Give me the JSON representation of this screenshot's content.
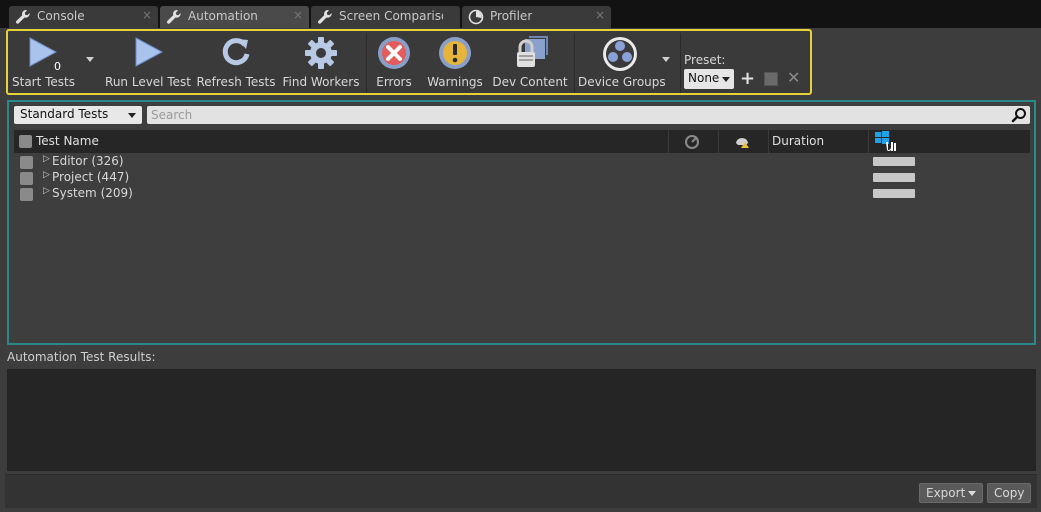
{
  "tabs": [
    {
      "label": "Console",
      "icon": "wrench-icon",
      "active": false
    },
    {
      "label": "Automation",
      "icon": "wrench-icon",
      "active": true
    },
    {
      "label": "Screen Comparison",
      "icon": "wrench-icon",
      "active": false
    },
    {
      "label": "Profiler",
      "icon": "profiler-icon",
      "active": false
    }
  ],
  "tab_close_glyph": "×",
  "toolbar": {
    "start_tests": "Start Tests",
    "start_tests_count": "0",
    "run_level_test": "Run Level Test",
    "refresh_tests": "Refresh Tests",
    "find_workers": "Find Workers",
    "errors": "Errors",
    "warnings": "Warnings",
    "dev_content": "Dev Content",
    "device_groups": "Device Groups",
    "preset_label": "Preset:",
    "preset_value": "None",
    "preset_add": "+",
    "preset_remove": "✕"
  },
  "filter": {
    "selected": "Standard Tests",
    "search_placeholder": "Search"
  },
  "table": {
    "columns": {
      "name": "Test Name",
      "duration": "Duration"
    },
    "rows": [
      {
        "label": "Editor (326)"
      },
      {
        "label": "Project (447)"
      },
      {
        "label": "System (209)"
      }
    ]
  },
  "results": {
    "label": "Automation Test Results:"
  },
  "footer": {
    "export": "Export",
    "copy": "Copy"
  },
  "colors": {
    "toolbar_border": "#e6d23a",
    "tests_border": "#2a8a8a",
    "accent_blue": "#1fa3e8"
  }
}
